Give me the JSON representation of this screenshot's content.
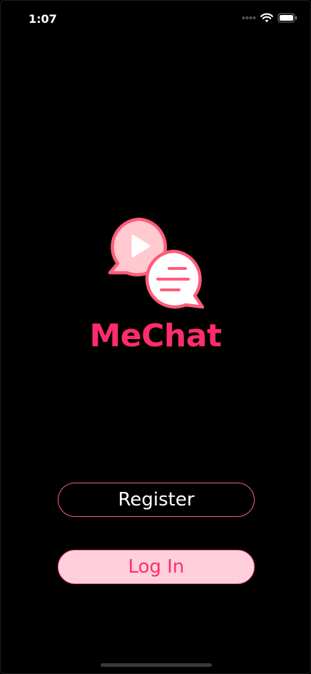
{
  "status_bar": {
    "time": "1:07",
    "icons": [
      "cellular-dots-icon",
      "wifi-icon",
      "battery-icon"
    ]
  },
  "app": {
    "title": "MeChat",
    "logo_icon": "chat-bubbles-logo-icon"
  },
  "buttons": {
    "register_label": "Register",
    "login_label": "Log In"
  },
  "colors": {
    "background": "#000000",
    "accent": "#ff2d6b",
    "accent_light": "#ffd0db",
    "logo_stroke": "#ff5c78",
    "logo_fill": "#ffc9cf"
  }
}
